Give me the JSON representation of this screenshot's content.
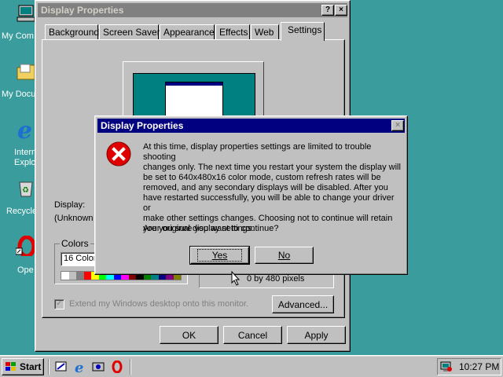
{
  "desktop": {
    "icons": [
      {
        "label": "My Com",
        "icon": "my-computer-icon"
      },
      {
        "label": "My Docu",
        "icon": "my-documents-icon"
      },
      {
        "label": "Intern",
        "label2": "Explo",
        "icon": "internet-explorer-icon"
      },
      {
        "label": "Recycle",
        "icon": "recycle-bin-icon"
      },
      {
        "label": "Ope",
        "icon": "opera-icon"
      }
    ]
  },
  "window": {
    "title": "Display Properties",
    "help_label": "?",
    "close_label": "×",
    "tabs": [
      "Background",
      "Screen Saver",
      "Appearance",
      "Effects",
      "Web",
      "Settings"
    ],
    "active_tab": "Settings",
    "display_label": "Display:",
    "display_value": "(Unknown",
    "colors_label": "Colors",
    "colors_value": "16 Color",
    "screen_area_value": "0 by 480 pixels",
    "extend_checkbox_label": "Extend my Windows desktop onto this monitor.",
    "advanced_label": "Advanced...",
    "ok_label": "OK",
    "cancel_label": "Cancel",
    "apply_label": "Apply"
  },
  "dialog": {
    "title": "Display Properties",
    "close_label": "×",
    "icon": "error-icon",
    "message": "At this time, display properties settings are limited to trouble shooting\nchanges only.  The next time you restart your system the display will\nbe set to 640x480x16 color mode, custom refresh rates will be\nremoved, and any secondary displays will be disabled.  After you\nhave restarted successfully, you will be able to change your driver or\nmake other settings changes.  Choosing not to continue will retain\nyour original display settings.",
    "question": "Are you sure you want to continue?",
    "yes_label": "Yes",
    "no_label": "No"
  },
  "taskbar": {
    "start_label": "Start",
    "quicklaunch": [
      "desktop-icon",
      "ie-icon",
      "channels-icon",
      "opera-icon"
    ],
    "time": "10:27 PM"
  },
  "colors": {
    "desktop": "#3a9c9c",
    "face": "#c0c0c0",
    "active_title": "#000080",
    "inactive_title": "#808080",
    "error_red": "#e00000"
  }
}
